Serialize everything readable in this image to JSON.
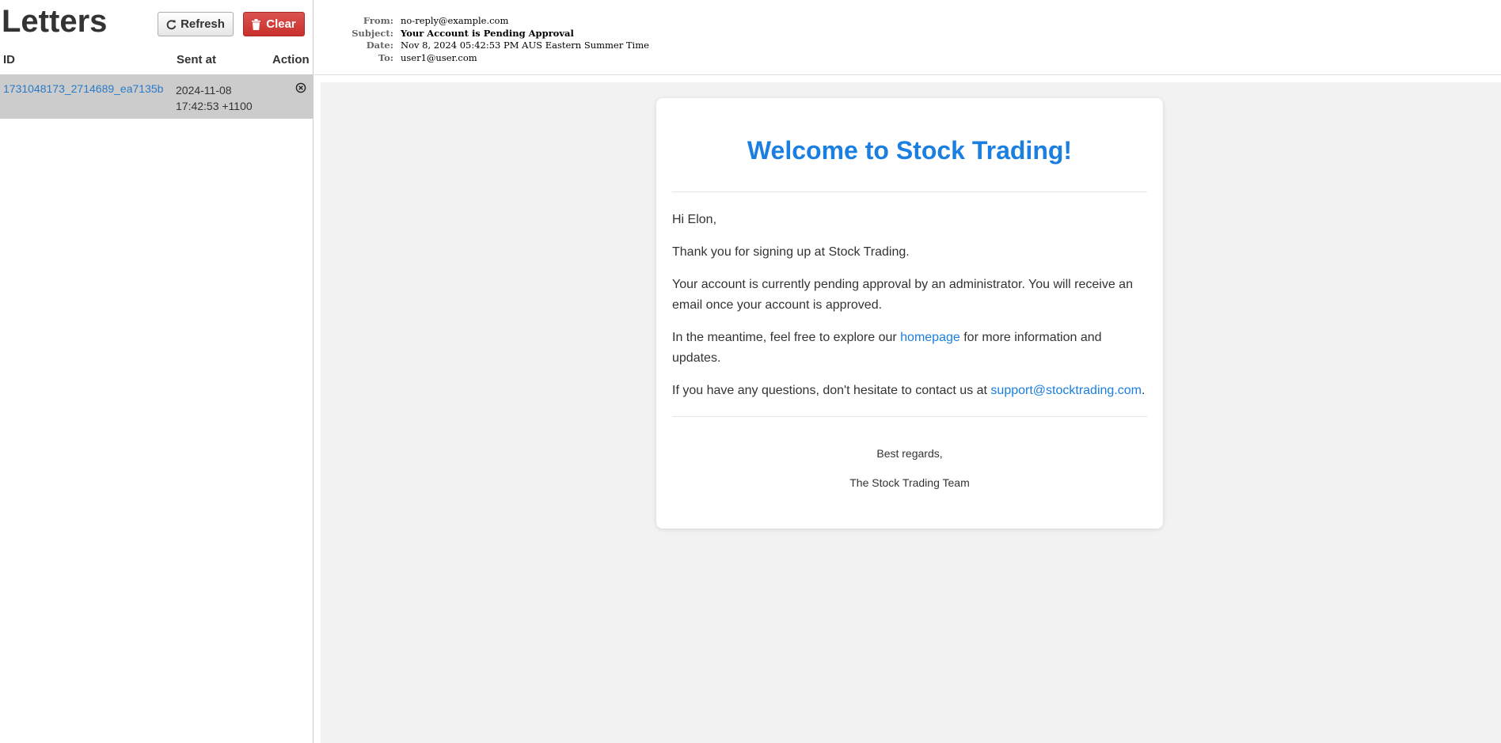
{
  "app": {
    "title": "Letters",
    "refresh_label": "Refresh",
    "clear_label": "Clear",
    "clear_color": "#d9534f"
  },
  "list": {
    "columns": {
      "id": "ID",
      "sent_at": "Sent at",
      "action": "Action"
    },
    "rows": [
      {
        "id": "1731048173_2714689_ea7135b",
        "sent_date": "2024-11-08",
        "sent_time": "17:42:53 +1100",
        "action_icon": "remove-circle-icon",
        "selected": true
      }
    ]
  },
  "headers": {
    "from_label": "From:",
    "from": "no-reply@example.com",
    "subject_label": "Subject:",
    "subject": "Your Account is Pending Approval",
    "date_label": "Date:",
    "date": "Nov 8, 2024 05:42:53 PM AUS Eastern Summer Time",
    "to_label": "To:",
    "to": "user1@user.com"
  },
  "email": {
    "heading": "Welcome to Stock Trading!",
    "heading_color": "#1a7fe0",
    "greeting": "Hi Elon,",
    "p1": "Thank you for signing up at Stock Trading.",
    "p2": "Your account is currently pending approval by an administrator. You will receive an email once your account is approved.",
    "p3_before": "In the meantime, feel free to explore our ",
    "p3_link": "homepage",
    "p3_after": " for more information and updates.",
    "p4_before": "If you have any questions, don't hesitate to contact us at ",
    "p4_link": "support@stocktrading.com",
    "p4_after": ".",
    "sign_off": "Best regards,",
    "team": "The Stock Trading Team"
  }
}
